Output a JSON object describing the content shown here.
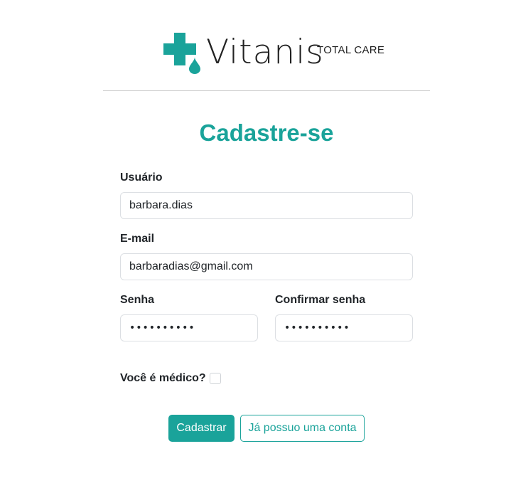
{
  "brand": {
    "name": "Vitanis",
    "tagline": "TOTAL CARE",
    "logo_icon": "medical-cross-drop",
    "accent_color": "#1aa39a"
  },
  "form": {
    "title": "Cadastre-se",
    "username": {
      "label": "Usuário",
      "value": "barbara.dias"
    },
    "email": {
      "label": "E-mail",
      "value": "barbaradias@gmail.com"
    },
    "password": {
      "label": "Senha",
      "value": "••••••••••"
    },
    "confirm_password": {
      "label": "Confirmar senha",
      "value": "••••••••••"
    },
    "is_doctor": {
      "label": "Você é médico?",
      "checked": false
    },
    "submit_label": "Cadastrar",
    "login_label": "Já possuo uma conta"
  }
}
